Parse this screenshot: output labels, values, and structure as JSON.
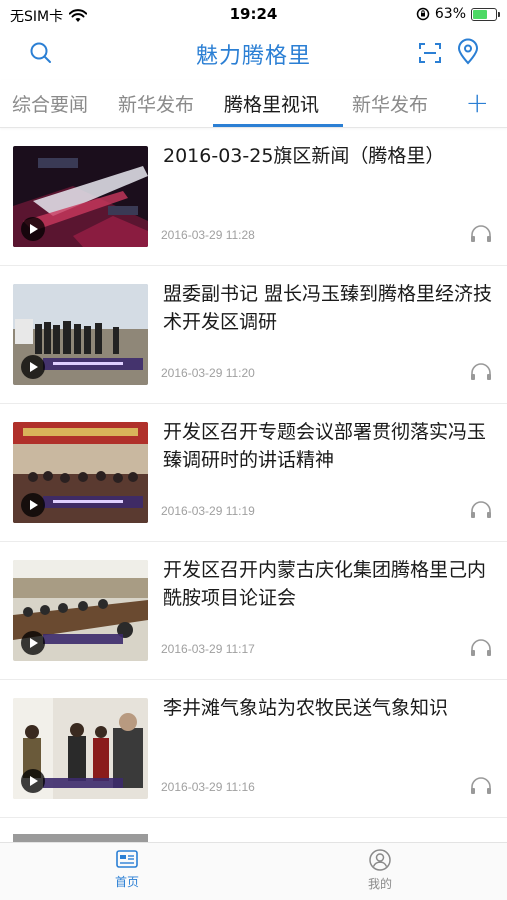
{
  "status_bar": {
    "carrier": "无SIM卡",
    "time": "19:24",
    "battery": "63%",
    "battery_level": 0.63
  },
  "nav": {
    "title": "魅力腾格里",
    "icons": [
      "search-icon",
      "scan-icon",
      "location-icon"
    ]
  },
  "tabs": [
    {
      "label": "综合要闻",
      "active": false
    },
    {
      "label": "新华发布",
      "active": false
    },
    {
      "label": "腾格里视讯",
      "active": true
    },
    {
      "label": "新华发布",
      "active": false
    }
  ],
  "tab_add_label": "+",
  "news": [
    {
      "title": "2016-03-25旗区新闻（腾格里）",
      "date": "2016-03-29 11:28",
      "thumb": "news-broadcast"
    },
    {
      "title": "盟委副书记 盟长冯玉臻到腾格里经济技术开发区调研",
      "date": "2016-03-29 11:20",
      "thumb": "field-visit"
    },
    {
      "title": "开发区召开专题会议部署贯彻落实冯玉臻调研时的讲话精神",
      "date": "2016-03-29 11:19",
      "thumb": "meeting-hall"
    },
    {
      "title": "开发区召开内蒙古庆化集团腾格里己内酰胺项目论证会",
      "date": "2016-03-29 11:17",
      "thumb": "conference-room"
    },
    {
      "title": "李井滩气象站为农牧民送气象知识",
      "date": "2016-03-29 11:16",
      "thumb": "indoor-visit"
    }
  ],
  "bottom_nav": [
    {
      "label": "首页",
      "icon": "home-icon",
      "active": true
    },
    {
      "label": "我的",
      "icon": "profile-icon",
      "active": false
    }
  ],
  "colors": {
    "accent": "#2b7fd4",
    "inactive_tab": "#8a8a8a",
    "date": "#a0a0a0"
  }
}
